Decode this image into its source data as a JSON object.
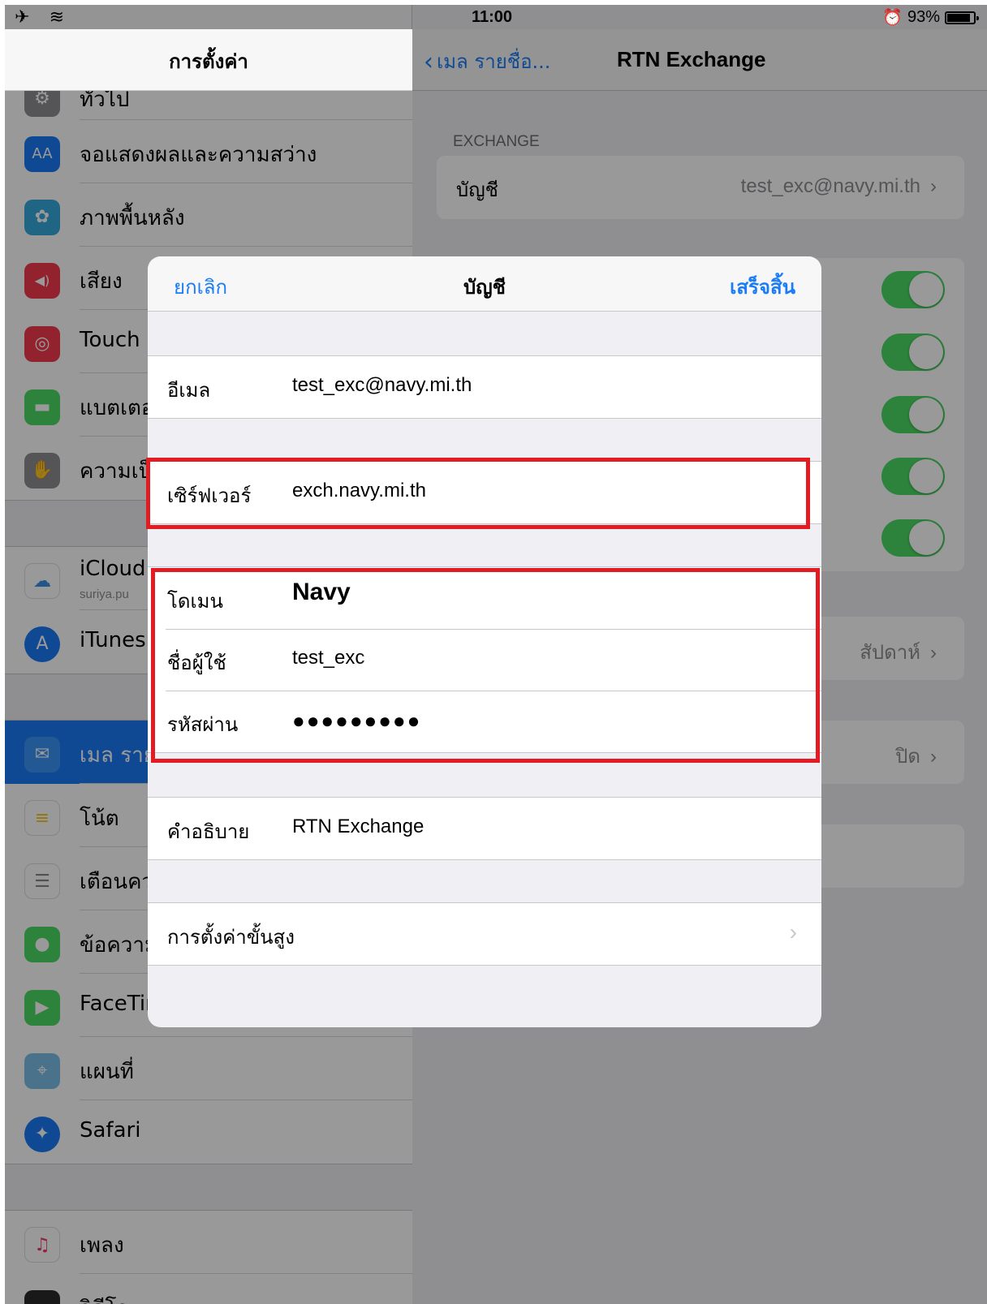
{
  "status_bar": {
    "left_icons": "✈ ︎ ≋",
    "time": "11:00",
    "battery_text": "93%"
  },
  "master": {
    "title": "การตั้งค่า",
    "items": [
      {
        "label": "ทั่วไป",
        "icon": "gear-icon",
        "glyph": "⚙",
        "color": "#8e8e93"
      },
      {
        "label": "จอแสดงผลและความสว่าง",
        "icon": "display-icon",
        "glyph": "AA",
        "color": "#1c7bf5"
      },
      {
        "label": "ภาพพื้นหลัง",
        "icon": "wallpaper-icon",
        "glyph": "✿",
        "color": "#36aadc"
      },
      {
        "label": "เสียง",
        "icon": "sound-icon",
        "glyph": "◀)",
        "color": "#f23a4e"
      },
      {
        "label": "Touch ID และรหัส",
        "visible_label": "Touch I",
        "icon": "fingerprint-icon",
        "glyph": "◎",
        "color": "#f23a4e"
      },
      {
        "label": "แบตเตอ",
        "icon": "battery-icon",
        "glyph": "▬",
        "color": "#4cd964"
      },
      {
        "label": "ความเป็",
        "icon": "privacy-hand-icon",
        "glyph": "✋",
        "color": "#8e8e93"
      },
      {
        "label": "iCloud",
        "sub": "suriya.pu",
        "icon": "icloud-icon",
        "glyph": "☁",
        "color": "#ffffff"
      },
      {
        "label": "iTunes",
        "icon": "app-store-icon",
        "glyph": "A",
        "color": "#1c7bf5"
      },
      {
        "label": "เมล ราย",
        "icon": "mail-icon",
        "glyph": "✉",
        "color": "#1c7bf5"
      },
      {
        "label": "โน้ต",
        "icon": "notes-icon",
        "glyph": "≡",
        "color": "#f5c31c"
      },
      {
        "label": "เตือนคว",
        "icon": "reminders-icon",
        "glyph": "☰",
        "color": "#ffffff"
      },
      {
        "label": "ข้อความ",
        "icon": "messages-icon",
        "glyph": "●",
        "color": "#4cd964"
      },
      {
        "label": "FaceTir",
        "icon": "facetime-icon",
        "glyph": "▶",
        "color": "#4cd964"
      },
      {
        "label": "แผนที่",
        "icon": "maps-icon",
        "glyph": "⌖",
        "color": "#7cc0e8"
      },
      {
        "label": "Safari",
        "icon": "safari-icon",
        "glyph": "✦",
        "color": "#1c7bf5"
      },
      {
        "label": "เพลง",
        "icon": "music-icon",
        "glyph": "♫",
        "color": "#ffffff"
      },
      {
        "label": "วิดีโอ",
        "icon": "videos-icon",
        "glyph": "▸▸",
        "color": "#2a2a2a"
      }
    ]
  },
  "detail": {
    "back_label": "เมล รายชื่อ...",
    "title": "RTN Exchange",
    "section_header": "EXCHANGE",
    "account_label": "บัญชี",
    "account_value": "test_exc@navy.mi.th",
    "week_value": "สัปดาห์",
    "off_value": "ปิด"
  },
  "modal": {
    "cancel": "ยกเลิก",
    "title": "บัญชี",
    "done": "เสร็จสิ้น",
    "fields": {
      "email_label": "อีเมล",
      "email_value": "test_exc@navy.mi.th",
      "server_label": "เซิร์ฟเวอร์",
      "server_value": "exch.navy.mi.th",
      "domain_label": "โดเมน",
      "domain_value": "Navy",
      "username_label": "ชื่อผู้ใช้",
      "username_value": "test_exc",
      "password_label": "รหัสผ่าน",
      "password_value": "●●●●●●●●●",
      "description_label": "คำอธิบาย",
      "description_value": "RTN Exchange",
      "advanced_label": "การตั้งค่าขั้นสูง"
    }
  },
  "colors": {
    "accent": "#1a7cf6",
    "toggle_on": "#4cd964",
    "highlight": "#e31b23"
  }
}
